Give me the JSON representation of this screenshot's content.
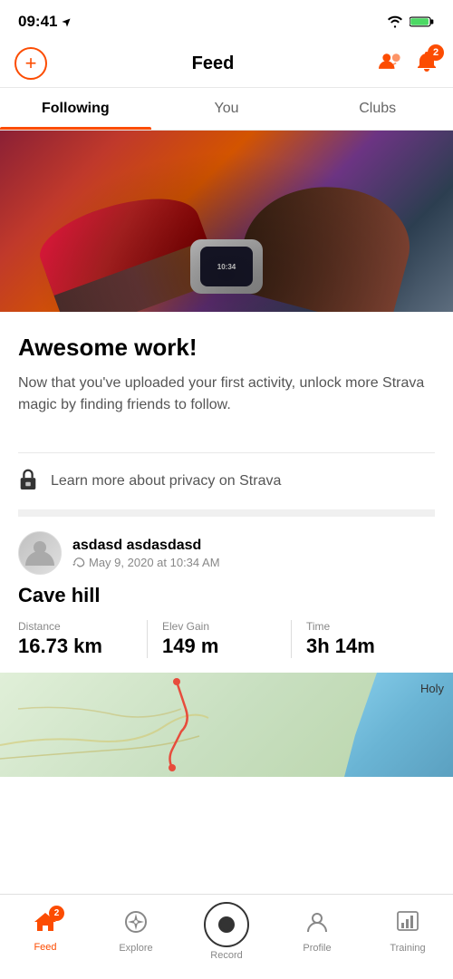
{
  "statusBar": {
    "time": "09:41",
    "locationArrow": "▶"
  },
  "header": {
    "title": "Feed",
    "addButton": "+",
    "notificationCount": "2"
  },
  "tabs": [
    {
      "label": "Following",
      "active": true
    },
    {
      "label": "You",
      "active": false
    },
    {
      "label": "Clubs",
      "active": false
    }
  ],
  "heroSection": {
    "title": "Awesome work!",
    "description": "Now that you've uploaded your first activity, unlock more Strava magic by finding friends to follow."
  },
  "privacyLink": {
    "text": "Learn more about privacy on Strava"
  },
  "activity": {
    "userName": "asdasd asdasdasd",
    "date": "May 9, 2020 at 10:34 AM",
    "title": "Cave hill",
    "stats": [
      {
        "label": "Distance",
        "value": "16.73 km"
      },
      {
        "label": "Elev Gain",
        "value": "149 m"
      },
      {
        "label": "Time",
        "value": "3h 14m"
      }
    ],
    "mapLabel": "Holy"
  },
  "bottomNav": [
    {
      "label": "Feed",
      "active": true,
      "badge": "2",
      "icon": "home"
    },
    {
      "label": "Explore",
      "active": false,
      "badge": null,
      "icon": "compass"
    },
    {
      "label": "Record",
      "active": false,
      "badge": null,
      "icon": "record"
    },
    {
      "label": "Profile",
      "active": false,
      "badge": null,
      "icon": "person"
    },
    {
      "label": "Training",
      "active": false,
      "badge": null,
      "icon": "chart"
    }
  ]
}
